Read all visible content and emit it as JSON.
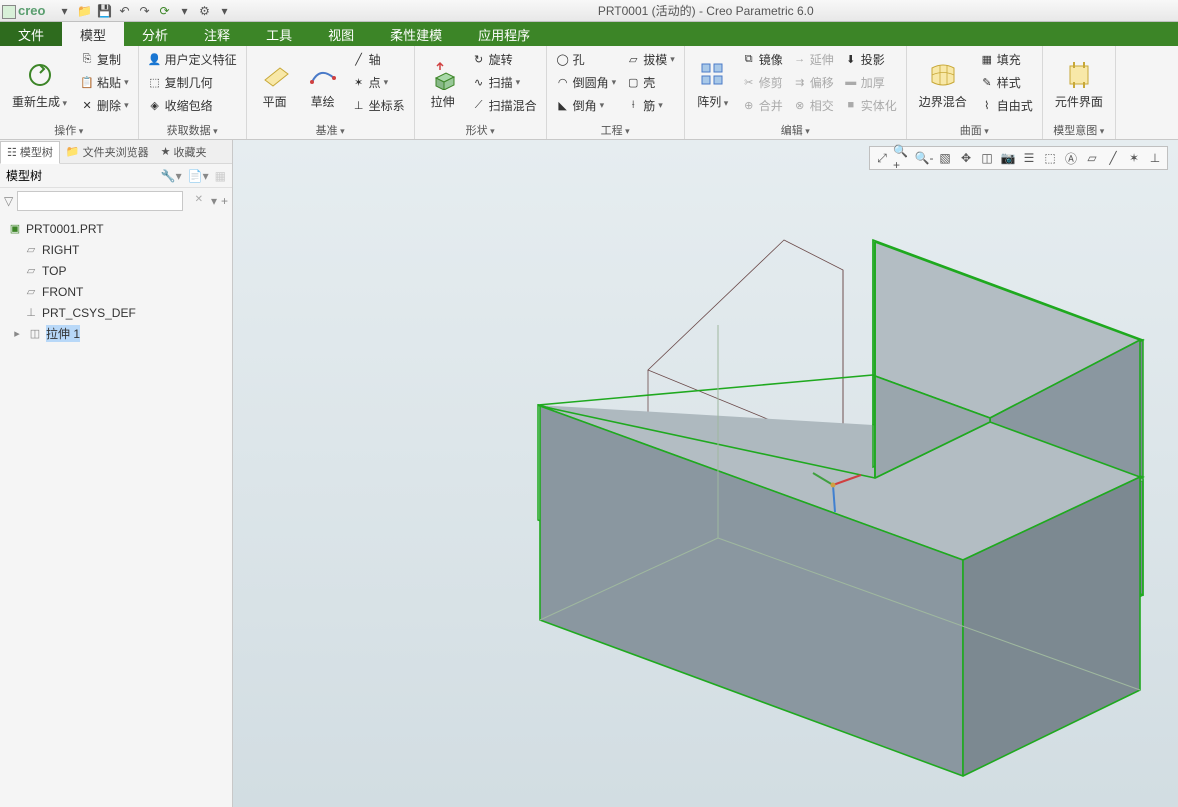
{
  "app": {
    "logo": "creo",
    "title": "PRT0001 (活动的) - Creo Parametric 6.0"
  },
  "qat": [
    "new",
    "open",
    "save",
    "undo",
    "redo",
    "regen",
    "windows",
    "close"
  ],
  "tabs": {
    "file": "文件",
    "items": [
      "模型",
      "分析",
      "注释",
      "工具",
      "视图",
      "柔性建模",
      "应用程序"
    ],
    "active": 0
  },
  "ribbon": {
    "groups": [
      {
        "label": "操作",
        "big": [
          {
            "name": "regenerate",
            "label": "重新生成",
            "dd": true
          }
        ],
        "cols": [
          [
            {
              "name": "copy",
              "label": "复制",
              "ic": "⎘"
            },
            {
              "name": "paste",
              "label": "粘贴",
              "ic": "📋",
              "dd": true
            },
            {
              "name": "delete",
              "label": "删除",
              "ic": "✕",
              "dd": true
            }
          ]
        ]
      },
      {
        "label": "获取数据",
        "cols": [
          [
            {
              "name": "user-feature",
              "label": "用户定义特征",
              "ic": "👤"
            },
            {
              "name": "copy-geom",
              "label": "复制几何",
              "ic": "⬚"
            },
            {
              "name": "shrinkwrap",
              "label": "收缩包络",
              "ic": "◈"
            }
          ]
        ]
      },
      {
        "label": "基准",
        "big": [
          {
            "name": "plane",
            "label": "平面"
          },
          {
            "name": "sketch",
            "label": "草绘"
          }
        ],
        "cols": [
          [
            {
              "name": "axis",
              "label": "轴",
              "ic": "╱"
            },
            {
              "name": "point",
              "label": "点",
              "ic": "✶",
              "dd": true
            },
            {
              "name": "csys",
              "label": "坐标系",
              "ic": "⊥"
            }
          ]
        ]
      },
      {
        "label": "形状",
        "big": [
          {
            "name": "extrude",
            "label": "拉伸"
          }
        ],
        "cols": [
          [
            {
              "name": "revolve",
              "label": "旋转",
              "ic": "↻"
            },
            {
              "name": "sweep",
              "label": "扫描",
              "ic": "∿",
              "dd": true
            },
            {
              "name": "sweep-blend",
              "label": "扫描混合",
              "ic": "⟋"
            }
          ]
        ]
      },
      {
        "label": "工程",
        "cols": [
          [
            {
              "name": "hole",
              "label": "孔",
              "ic": "◯"
            },
            {
              "name": "round",
              "label": "倒圆角",
              "ic": "◠",
              "dd": true
            },
            {
              "name": "chamfer",
              "label": "倒角",
              "ic": "◣",
              "dd": true
            }
          ],
          [
            {
              "name": "draft",
              "label": "拔模",
              "ic": "▱",
              "dd": true
            },
            {
              "name": "shell",
              "label": "壳",
              "ic": "▢"
            },
            {
              "name": "rib",
              "label": "筋",
              "ic": "⟊",
              "dd": true
            }
          ]
        ]
      },
      {
        "label": "编辑",
        "big": [
          {
            "name": "pattern",
            "label": "阵列",
            "dd": true
          }
        ],
        "cols": [
          [
            {
              "name": "mirror",
              "label": "镜像",
              "ic": "⧉"
            },
            {
              "name": "trim",
              "label": "修剪",
              "ic": "✂",
              "disabled": true
            },
            {
              "name": "merge",
              "label": "合并",
              "ic": "⊕",
              "disabled": true
            }
          ],
          [
            {
              "name": "extend",
              "label": "延伸",
              "ic": "→",
              "disabled": true
            },
            {
              "name": "offset",
              "label": "偏移",
              "ic": "⇉",
              "disabled": true
            },
            {
              "name": "intersect",
              "label": "相交",
              "ic": "⊗",
              "disabled": true
            }
          ],
          [
            {
              "name": "project",
              "label": "投影",
              "ic": "⬇"
            },
            {
              "name": "thicken",
              "label": "加厚",
              "ic": "▬",
              "disabled": true
            },
            {
              "name": "solidify",
              "label": "实体化",
              "ic": "■",
              "disabled": true
            }
          ]
        ]
      },
      {
        "label": "曲面",
        "big": [
          {
            "name": "boundary-blend",
            "label": "边界混合"
          }
        ],
        "cols": [
          [
            {
              "name": "fill",
              "label": "填充",
              "ic": "▦"
            },
            {
              "name": "style",
              "label": "样式",
              "ic": "✎"
            },
            {
              "name": "freestyle",
              "label": "自由式",
              "ic": "⌇"
            }
          ]
        ]
      },
      {
        "label": "模型意图",
        "big": [
          {
            "name": "component-interface",
            "label": "元件界面"
          }
        ]
      }
    ]
  },
  "side": {
    "tabs": [
      "模型树",
      "文件夹浏览器",
      "收藏夹"
    ],
    "active": 0,
    "header": "模型树",
    "tree": {
      "root": "PRT0001.PRT",
      "items": [
        {
          "name": "right",
          "label": "RIGHT",
          "ic": "▱"
        },
        {
          "name": "top",
          "label": "TOP",
          "ic": "▱"
        },
        {
          "name": "front",
          "label": "FRONT",
          "ic": "▱"
        },
        {
          "name": "csys",
          "label": "PRT_CSYS_DEF",
          "ic": "⊥"
        },
        {
          "name": "extrude1",
          "label": "拉伸 1",
          "ic": "◫",
          "selected": true,
          "expandable": true
        }
      ]
    }
  },
  "viewToolbar": [
    "refit",
    "zoom-in",
    "zoom-out",
    "repaint",
    "spin",
    "display-style",
    "saved-views",
    "layers",
    "perspective",
    "annotations",
    "datum-planes",
    "datum-axes",
    "datum-points",
    "datum-csys"
  ]
}
